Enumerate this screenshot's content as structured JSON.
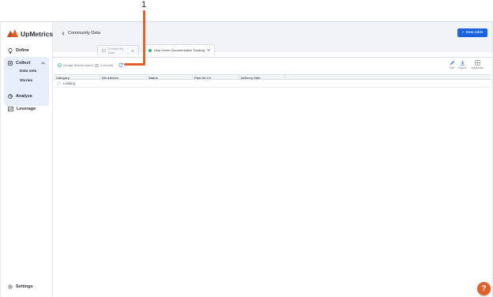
{
  "annotation": {
    "marker": "1"
  },
  "brand": {
    "name": "UpMetrics",
    "accent": "#e0612b",
    "primary": "#1a63e0"
  },
  "sidebar": {
    "items": [
      {
        "label": "Define",
        "icon": "lightbulb-icon"
      },
      {
        "label": "Collect",
        "icon": "collect-icon"
      },
      {
        "label": "Analyze",
        "icon": "analyze-icon"
      },
      {
        "label": "Leverage",
        "icon": "leverage-icon"
      }
    ],
    "collect_sub": [
      {
        "label": "Data sets"
      },
      {
        "label": "Stories"
      }
    ],
    "settings_label": "Settings"
  },
  "header": {
    "breadcrumb": "Community Data",
    "primary_button": "Data table"
  },
  "tabs": [
    {
      "label": "Community Data"
    },
    {
      "label": "Help Center Documentation Tracking"
    }
  ],
  "toolbar": {
    "import_label": "Google Sheets Import",
    "records_label": "0 records",
    "actions": [
      {
        "label": "Edit",
        "icon": "pencil-icon"
      },
      {
        "label": "Export",
        "icon": "download-icon"
      },
      {
        "label": "Advanced",
        "icon": "grid-icon"
      }
    ]
  },
  "table": {
    "columns": [
      "Category",
      "DG Articles",
      "Status",
      "Plan for 2.0",
      "Delivery Date"
    ],
    "loading_text": "Loading"
  },
  "help": {
    "label": "?"
  }
}
